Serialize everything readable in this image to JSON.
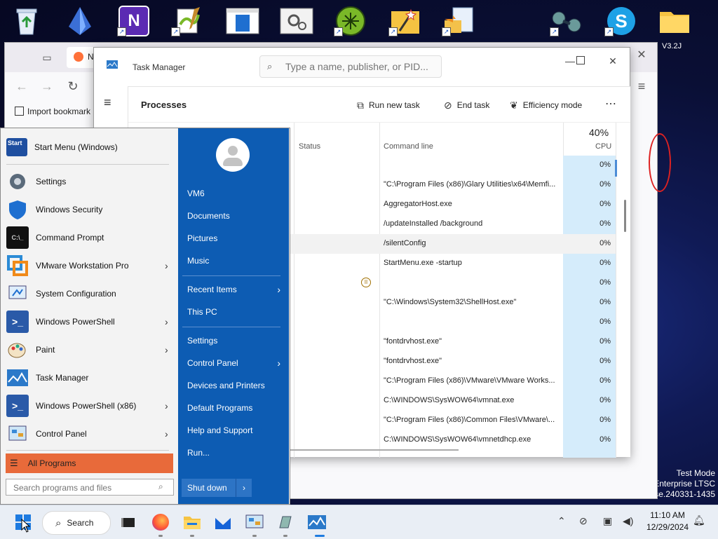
{
  "desktop": {
    "icons": [
      {
        "name": "recycle-bin-icon",
        "color": "#dfe9f5"
      },
      {
        "name": "crystal-icon",
        "color": "#3b6fd6"
      },
      {
        "name": "onenote-icon",
        "color": "#5b2bb3"
      },
      {
        "name": "notepad-plus-icon",
        "color": "#8bc34a"
      },
      {
        "name": "window-app-icon",
        "color": "#1f6fd0"
      },
      {
        "name": "settings-gear-app-icon",
        "color": "#e8e8e8"
      },
      {
        "name": "glary-utilities-icon",
        "color": "#7ab828"
      },
      {
        "name": "magic-wand-icon",
        "color": "#f2b33d"
      },
      {
        "name": "file-move-icon",
        "color": "#f3c14a"
      },
      {
        "name": "binoculars-icon",
        "color": "#5a8a8a"
      },
      {
        "name": "skype-icon",
        "color": "#1ea1e6"
      },
      {
        "name": "folder-icon",
        "color": "#f5c342"
      }
    ],
    "version_label": "V3.2J",
    "watermark": [
      "Test Mode",
      "Enterprise LTSC",
      "ase.240331-1435"
    ]
  },
  "firefox": {
    "bookmark_label": "Import bookmark",
    "tab_initial": "N"
  },
  "task_manager": {
    "title": "Task Manager",
    "search_placeholder": "Type a name, publisher, or PID...",
    "heading": "Processes",
    "actions": {
      "run_new_task": "Run new task",
      "end_task": "End task",
      "efficiency_mode": "Efficiency mode",
      "more": "⋯"
    },
    "columns": {
      "status": "Status",
      "command_line": "Command line",
      "cpu_total": "40%",
      "cpu": "CPU"
    },
    "rows": [
      {
        "cmd": "",
        "cpu": "0%"
      },
      {
        "cmd": "\"C:\\Program Files (x86)\\Glary Utilities\\x64\\Memfi...",
        "cpu": "0%"
      },
      {
        "cmd": "AggregatorHost.exe",
        "cpu": "0%"
      },
      {
        "cmd": " /updateInstalled /background",
        "cpu": "0%"
      },
      {
        "cmd": "/silentConfig",
        "cpu": "0%"
      },
      {
        "cmd": "StartMenu.exe -startup",
        "cpu": "0%"
      },
      {
        "cmd": "",
        "cpu": "0%"
      },
      {
        "cmd": "\"C:\\Windows\\System32\\ShellHost.exe\"",
        "cpu": "0%"
      },
      {
        "cmd": "",
        "cpu": "0%"
      },
      {
        "cmd": "\"fontdrvhost.exe\"",
        "cpu": "0%"
      },
      {
        "cmd": "\"fontdrvhost.exe\"",
        "cpu": "0%"
      },
      {
        "cmd": "\"C:\\Program Files (x86)\\VMware\\VMware Works...",
        "cpu": "0%"
      },
      {
        "cmd": "C:\\WINDOWS\\SysWOW64\\vmnat.exe",
        "cpu": "0%"
      },
      {
        "cmd": "\"C:\\Program Files (x86)\\Common Files\\VMware\\...",
        "cpu": "0%"
      },
      {
        "cmd": "C:\\WINDOWS\\SysWOW64\\vmnetdhcp.exe",
        "cpu": "0%"
      }
    ]
  },
  "start_menu": {
    "header_item": "Start Menu (Windows)",
    "items": [
      {
        "label": "Settings"
      },
      {
        "label": "Windows Security"
      },
      {
        "label": "Command Prompt"
      },
      {
        "label": "VMware Workstation Pro"
      },
      {
        "label": "System Configuration"
      },
      {
        "label": "Windows PowerShell"
      },
      {
        "label": "Paint"
      },
      {
        "label": "Task Manager"
      },
      {
        "label": "Windows PowerShell (x86)"
      },
      {
        "label": "Control Panel"
      }
    ],
    "all_programs": "All Programs",
    "search_placeholder": "Search programs and files",
    "right": {
      "user": "VM6",
      "documents": "Documents",
      "pictures": "Pictures",
      "music": "Music",
      "recent_items": "Recent Items",
      "this_pc": "This PC",
      "settings": "Settings",
      "control_panel": "Control Panel",
      "devices_printers": "Devices and Printers",
      "default_programs": "Default Programs",
      "help_support": "Help and Support",
      "run": "Run..."
    },
    "shutdown": "Shut down",
    "start_icon_text": "Start"
  },
  "taskbar": {
    "search_label": "Search",
    "time": "11:10 AM",
    "date": "12/29/2024"
  },
  "colors": {
    "start_menu_right": "#0d5cb3",
    "all_programs": "#e86a3a",
    "cpu_column": "#d5ecfb"
  }
}
